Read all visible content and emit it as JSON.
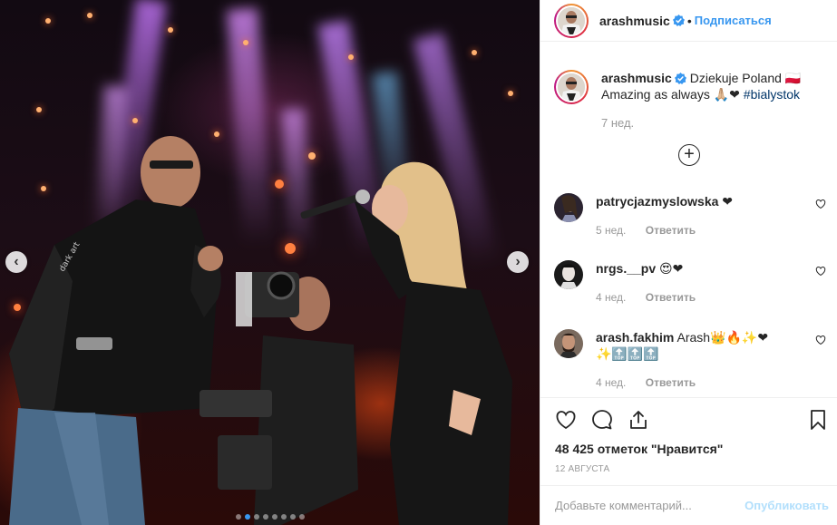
{
  "carousel": {
    "prev_icon": "chevron-left-icon",
    "next_icon": "chevron-right-icon",
    "slide_count": 8,
    "active_slide": 2
  },
  "header": {
    "username": "arashmusic",
    "verified_icon": "verified-badge-icon",
    "separator": "•",
    "follow_label": "Подписаться"
  },
  "caption": {
    "username": "arashmusic",
    "text_line1": "Dziekuje Poland 🇵🇱",
    "text_line2": "Amazing as always 🙏🏼❤",
    "hashtag": "#bialystok",
    "time": "7 нед."
  },
  "load_more_icon": "plus-circle-icon",
  "comments": [
    {
      "username": "patrycjazmyslowska",
      "text": "❤",
      "time": "5 нед.",
      "reply": "Ответить"
    },
    {
      "username": "nrgs.__pv",
      "text": "😍❤",
      "time": "4 нед.",
      "reply": "Ответить"
    },
    {
      "username": "arash.fakhim",
      "text": "Arash👑🔥✨❤",
      "text2": "✨🔝🔝🔝",
      "time": "4 нед.",
      "reply": "Ответить"
    }
  ],
  "actions": {
    "like_icon": "heart-icon",
    "comment_icon": "comment-icon",
    "share_icon": "share-icon",
    "save_icon": "bookmark-icon",
    "likes": "48 425 отметок \"Нравится\"",
    "date": "12 АВГУСТА"
  },
  "add_comment": {
    "placeholder": "Добавьте комментарий...",
    "publish_label": "Опубликовать"
  },
  "colors": {
    "accent": "#3897f0",
    "publish_disabled": "#b2dffc",
    "muted": "#999999",
    "hashtag": "#003569"
  }
}
